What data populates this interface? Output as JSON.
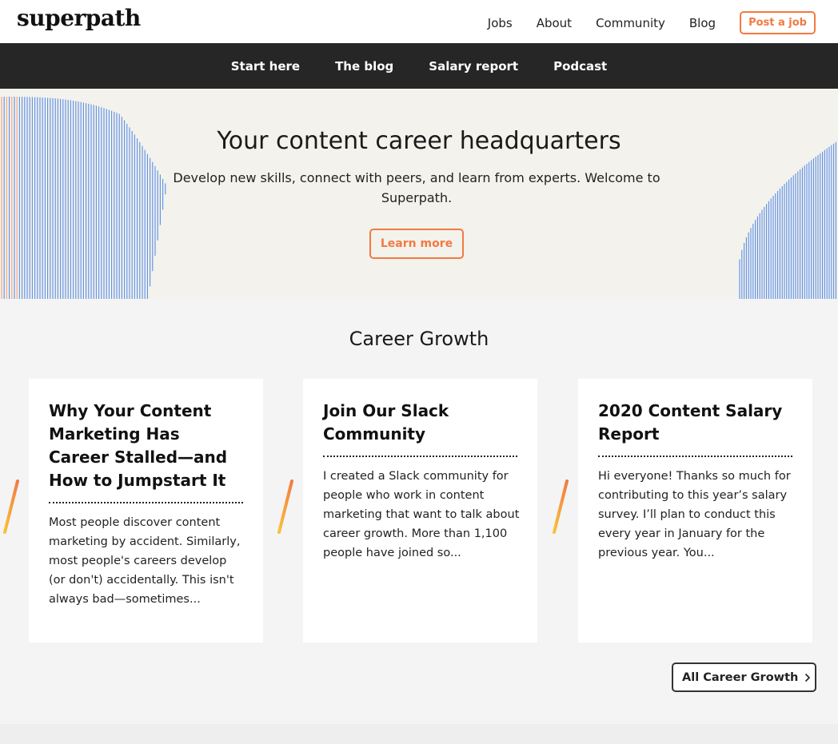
{
  "header": {
    "logo": "superpath",
    "nav": [
      "Jobs",
      "About",
      "Community",
      "Blog"
    ],
    "post_job": "Post a job"
  },
  "subnav": [
    "Start here",
    "The blog",
    "Salary report",
    "Podcast"
  ],
  "hero": {
    "title": "Your content career headquarters",
    "subtitle": "Develop new skills, connect with peers, and learn from experts. Welcome to Superpath.",
    "cta": "Learn more"
  },
  "section": {
    "title": "Career Growth",
    "cards": [
      {
        "title": "Why Your Content Marketing Has Career Stalled—and How to Jumpstart It",
        "excerpt": "Most people discover content marketing by accident. Similarly, most people's careers develop (or don't) accidentally. This isn't always bad—sometimes..."
      },
      {
        "title": "Join Our Slack Community",
        "excerpt": "I created a Slack community for people who work in content marketing that want to talk about career growth. More than 1,100 people have joined so..."
      },
      {
        "title": "2020 Content Salary Report",
        "excerpt": "Hi everyone! Thanks so much for contributing to this year’s salary survey. I’ll plan to conduct this every year in January for the previous year. You..."
      }
    ],
    "all_button": "All Career Growth"
  },
  "colors": {
    "accent": "#f27a42",
    "dark_nav": "#262626",
    "hero_bg": "#f3f2ec",
    "deco_lines": "#5b8ee8"
  }
}
